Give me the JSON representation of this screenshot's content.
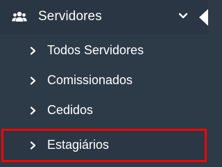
{
  "menu": {
    "section": {
      "label": "Servidores",
      "icon": "users-icon",
      "expanded_icon": "chevron-down-icon"
    },
    "items": [
      {
        "label": "Todos Servidores",
        "icon": "chevron-right-icon",
        "highlighted": false
      },
      {
        "label": "Comissionados",
        "icon": "chevron-right-icon",
        "highlighted": false
      },
      {
        "label": "Cedidos",
        "icon": "chevron-right-icon",
        "highlighted": false
      },
      {
        "label": "Estagiários",
        "icon": "chevron-right-icon",
        "highlighted": true
      }
    ]
  },
  "colors": {
    "background": "#2d3a48",
    "text": "#ffffff",
    "highlight_border": "#ff0000"
  }
}
